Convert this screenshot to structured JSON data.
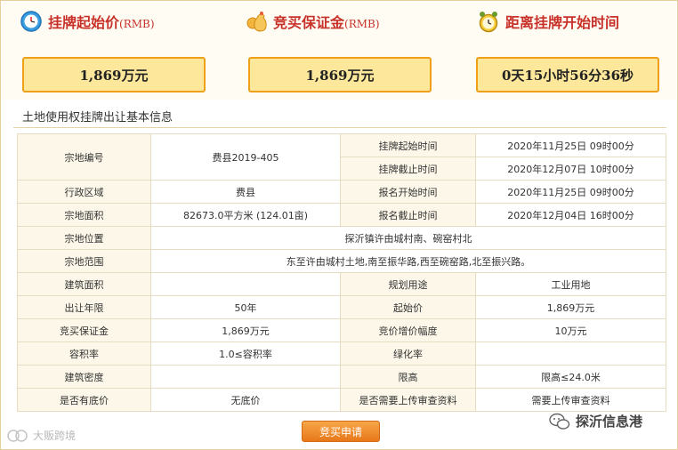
{
  "header": {
    "start_price": {
      "label": "挂牌起始价",
      "unit": "(RMB)",
      "value": "1,869万元",
      "icon": "clock-icon"
    },
    "deposit": {
      "label": "竞买保证金",
      "unit": "(RMB)",
      "value": "1,869万元",
      "icon": "money-bag-icon"
    },
    "countdown": {
      "label": "距离挂牌开始时间",
      "value": "0天15小时56分36秒",
      "icon": "alarm-clock-icon"
    }
  },
  "section_title": "土地使用权挂牌出让基本信息",
  "table": {
    "parcel_no_label": "宗地编号",
    "parcel_no": "费县2019-405",
    "listing_start_label": "挂牌起始时间",
    "listing_start": "2020年11月25日 09时00分",
    "listing_end_label": "挂牌截止时间",
    "listing_end": "2020年12月07日 10时00分",
    "district_label": "行政区域",
    "district": "费县",
    "reg_start_label": "报名开始时间",
    "reg_start": "2020年11月25日 09时00分",
    "area_label": "宗地面积",
    "area": "82673.0平方米 (124.01亩)",
    "reg_end_label": "报名截止时间",
    "reg_end": "2020年12月04日 16时00分",
    "location_label": "宗地位置",
    "location": "探沂镇许由城村南、碗窑村北",
    "scope_label": "宗地范围",
    "scope": "东至许由城村土地,南至振华路,西至碗窑路,北至振兴路。",
    "building_area_label": "建筑面积",
    "building_area": "",
    "planned_use_label": "规划用途",
    "planned_use": "工业用地",
    "term_label": "出让年限",
    "term": "50年",
    "start_price_label": "起始价",
    "start_price": "1,869万元",
    "deposit_label": "竞买保证金",
    "deposit": "1,869万元",
    "increment_label": "竞价增价幅度",
    "increment": "10万元",
    "far_label": "容积率",
    "far": "1.0≤容积率",
    "green_label": "绿化率",
    "green": "",
    "density_label": "建筑密度",
    "density": "",
    "height_label": "限高",
    "height": "限高≤24.0米",
    "reserve_label": "是否有底价",
    "reserve": "无底价",
    "upload_label": "是否需要上传审查资料",
    "upload": "需要上传审查资料"
  },
  "apply_button": "竞买申请",
  "watermark_left": "大贩跨境",
  "watermark_right": "探沂信息港"
}
